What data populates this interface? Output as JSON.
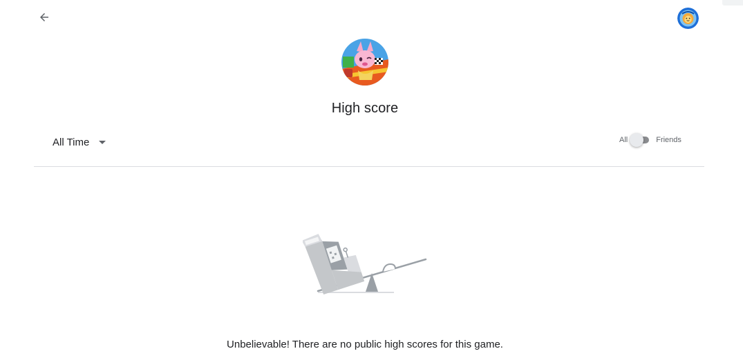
{
  "header": {
    "back_icon": "arrow-back-icon",
    "avatar_icon": "user-avatar-icon"
  },
  "game": {
    "icon": "game-icon",
    "title": "High score"
  },
  "filters": {
    "time_range": "All Time",
    "toggle_left_label": "All",
    "toggle_right_label": "Friends",
    "toggle_state": "All"
  },
  "empty_state": {
    "illustration": "arcade-seesaw-illustration",
    "message": "Unbelievable! There are no public high scores for this game."
  },
  "colors": {
    "text_primary": "#202124",
    "text_secondary": "#5f6368",
    "divider": "#dadce0",
    "toggle_track": "#8a8c8f"
  }
}
